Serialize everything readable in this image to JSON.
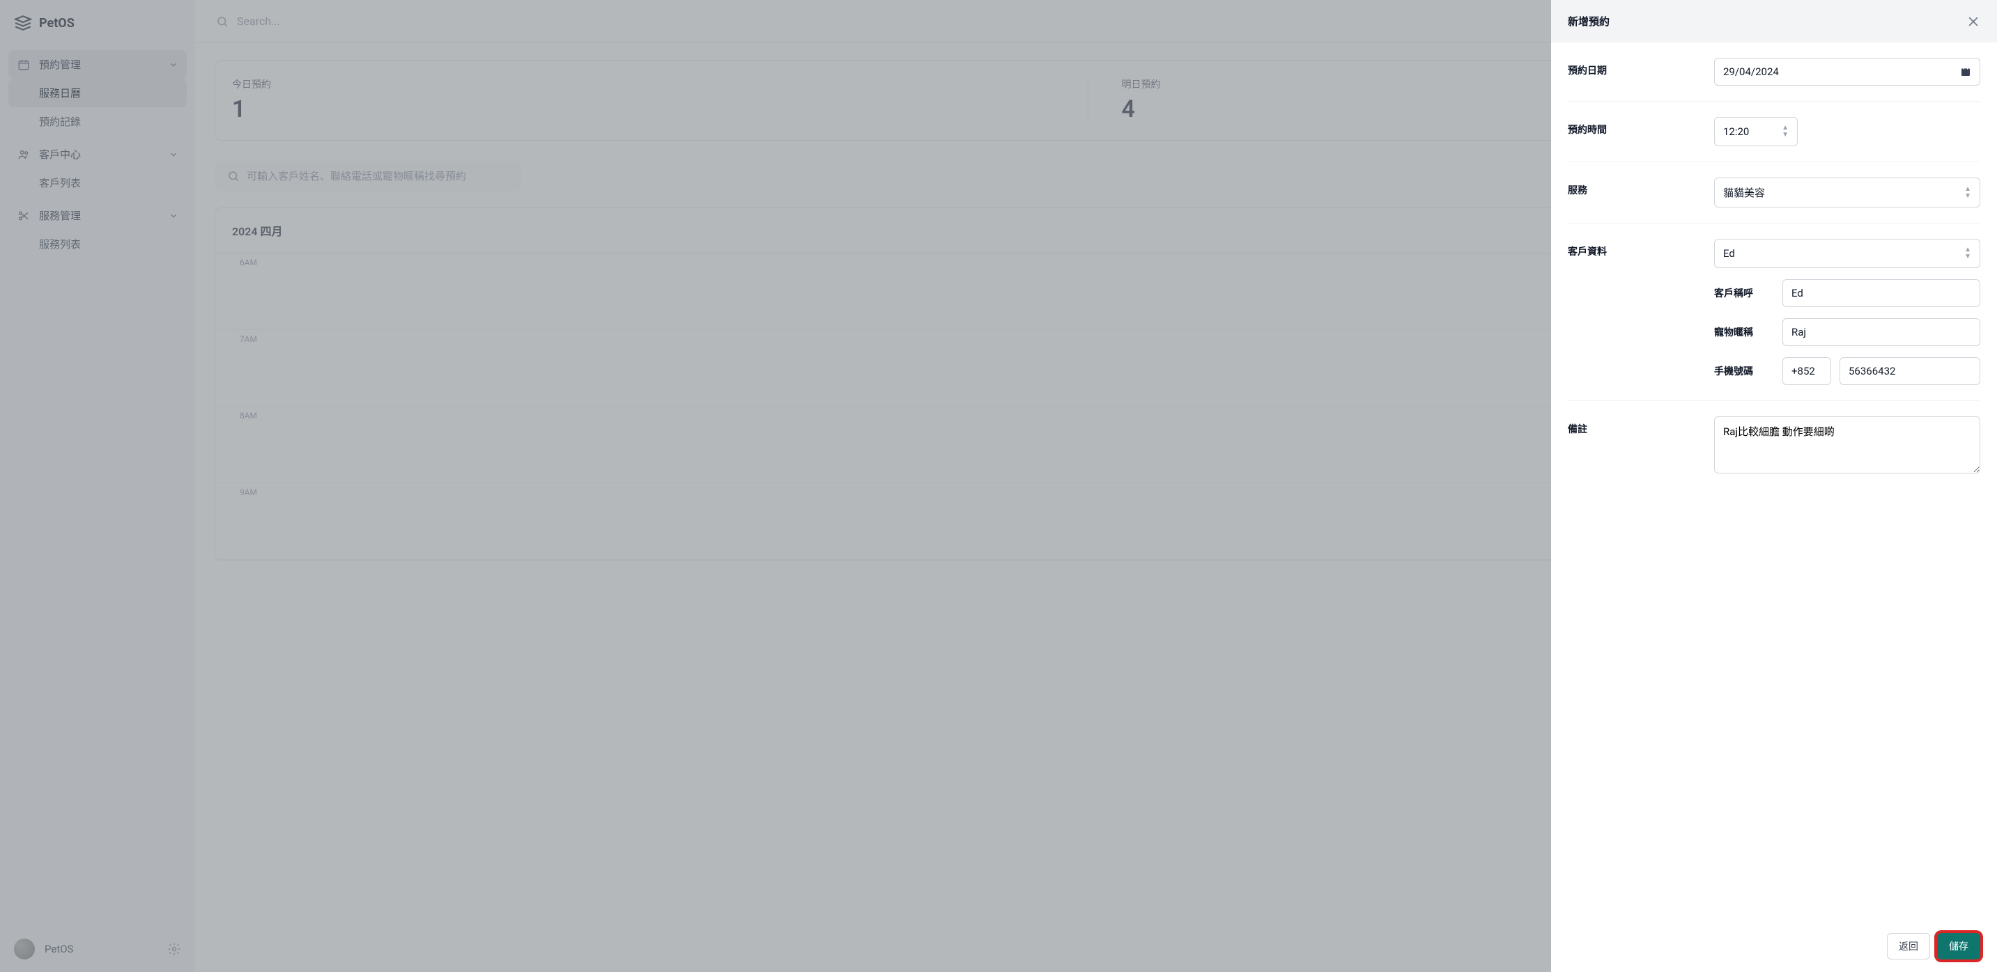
{
  "app": {
    "name": "PetOS"
  },
  "sidebar": {
    "groups": [
      {
        "label": "預約管理",
        "items": [
          {
            "label": "服務日曆"
          },
          {
            "label": "預約記錄"
          }
        ]
      },
      {
        "label": "客戶中心",
        "items": [
          {
            "label": "客戶列表"
          }
        ]
      },
      {
        "label": "服務管理",
        "items": [
          {
            "label": "服務列表"
          }
        ]
      }
    ],
    "footer": {
      "name": "PetOS"
    }
  },
  "topbar": {
    "search_placeholder": "Search..."
  },
  "stats": [
    {
      "label": "今日預約",
      "value": "1"
    },
    {
      "label": "明日預約",
      "value": "4"
    }
  ],
  "booking_search_placeholder": "可輸入客戶姓名、聯絡電話或寵物暱稱找尋預約",
  "calendar": {
    "title": "2024 四月",
    "hours": [
      "6AM",
      "7AM",
      "8AM",
      "9AM"
    ]
  },
  "panel": {
    "title": "新增預約",
    "fields": {
      "date": {
        "label": "預約日期",
        "value": "29/04/2024"
      },
      "time": {
        "label": "預約時間",
        "value": "12:20"
      },
      "service": {
        "label": "服務",
        "value": "貓貓美容"
      },
      "customer": {
        "label": "客戶資料",
        "value": "Ed",
        "name_label": "客戶稱呼",
        "name_value": "Ed",
        "pet_label": "寵物暱稱",
        "pet_value": "Raj",
        "phone_label": "手機號碼",
        "phone_cc": "+852",
        "phone_number": "56366432"
      },
      "remark": {
        "label": "備註",
        "value": "Raj比較細膽 動作要細啲"
      }
    },
    "buttons": {
      "back": "返回",
      "save": "儲存"
    }
  }
}
